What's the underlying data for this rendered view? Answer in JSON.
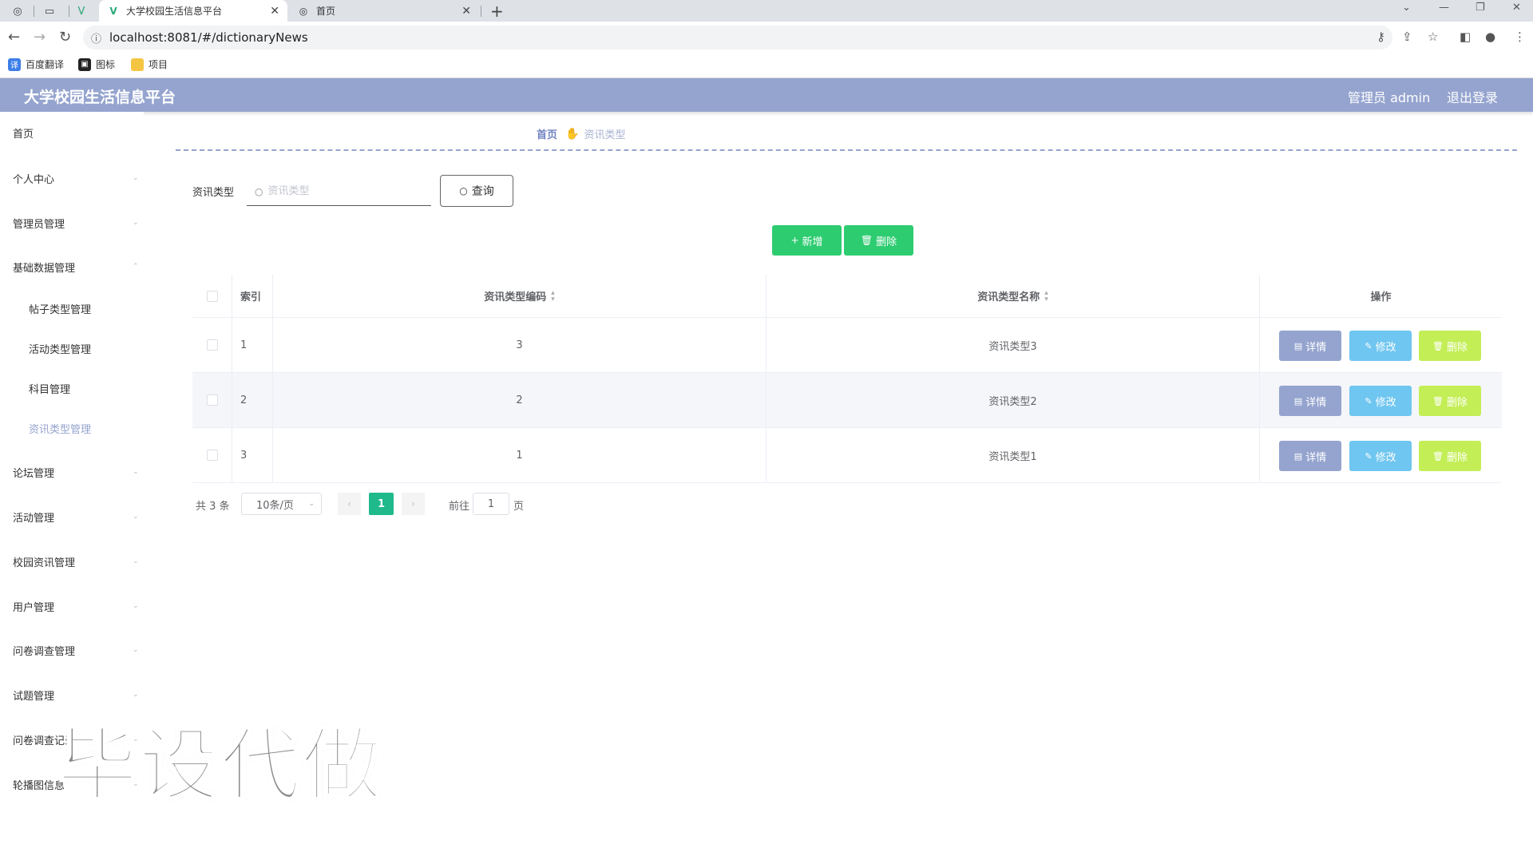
{
  "browser": {
    "tabs": [
      {
        "title": "大学校园生活信息平台",
        "active": true
      },
      {
        "title": "首页",
        "active": false
      }
    ],
    "url": "localhost:8081/#/dictionaryNews",
    "bookmarks": [
      "百度翻译",
      "图标",
      "项目"
    ]
  },
  "header": {
    "title": "大学校园生活信息平台",
    "user": "管理员 admin",
    "logout": "退出登录"
  },
  "sidebar": {
    "items": [
      {
        "label": "首页",
        "caret": false
      },
      {
        "label": "个人中心",
        "caret": true
      },
      {
        "label": "管理员管理",
        "caret": true
      },
      {
        "label": "基础数据管理",
        "caret": true
      },
      {
        "label": "帖子类型管理",
        "sub": true
      },
      {
        "label": "活动类型管理",
        "sub": true
      },
      {
        "label": "科目管理",
        "sub": true
      },
      {
        "label": "资讯类型管理",
        "sub": true,
        "active": true
      },
      {
        "label": "论坛管理",
        "caret": true
      },
      {
        "label": "活动管理",
        "caret": true
      },
      {
        "label": "校园资讯管理",
        "caret": true
      },
      {
        "label": "用户管理",
        "caret": true
      },
      {
        "label": "问卷调查管理",
        "caret": true
      },
      {
        "label": "试题管理",
        "caret": true
      },
      {
        "label": "问卷调查记录",
        "caret": true
      },
      {
        "label": "轮播图信息",
        "caret": true
      }
    ]
  },
  "breadcrumb": {
    "home": "首页",
    "current": "资讯类型"
  },
  "search": {
    "label": "资讯类型",
    "placeholder": "资讯类型",
    "button": "查询"
  },
  "actions": {
    "add": "新增",
    "delete": "删除"
  },
  "table": {
    "columns": {
      "index": "索引",
      "code": "资讯类型编码",
      "name": "资讯类型名称",
      "ops": "操作"
    },
    "rows": [
      {
        "index": "1",
        "code": "3",
        "name": "资讯类型3"
      },
      {
        "index": "2",
        "code": "2",
        "name": "资讯类型2"
      },
      {
        "index": "3",
        "code": "1",
        "name": "资讯类型1"
      }
    ],
    "op_labels": {
      "detail": "详情",
      "edit": "修改",
      "delete": "删除"
    }
  },
  "pagination": {
    "total": "共 3 条",
    "page_size": "10条/页",
    "current_page": "1",
    "goto_label": "前往",
    "goto_value": "1",
    "goto_unit": "页"
  },
  "watermark": "毕设代做",
  "colors": {
    "header": "#95a4cf",
    "green": "#2ecc71",
    "detail": "#95a4cf",
    "edit": "#6fc6f0",
    "delete": "#c3ee56",
    "page_active": "#1fb98c"
  }
}
